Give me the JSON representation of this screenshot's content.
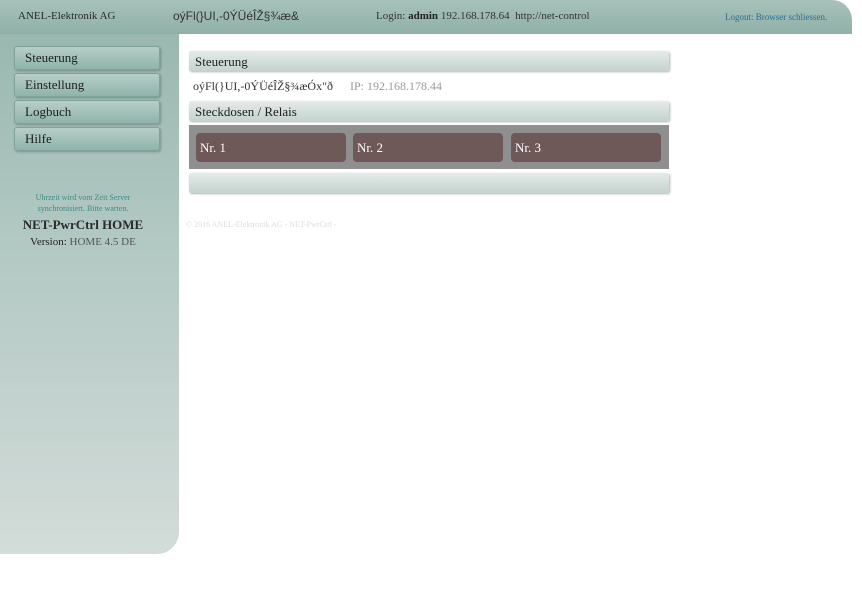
{
  "header": {
    "brand": "ANEL-Elektronik AG",
    "device_name": "oýFl(}UI,-0ÝÜéÎŽ§¾æ&",
    "login_label": "Login:",
    "login_user": "admin",
    "login_ip": "192.168.178.64",
    "login_host": "http://net-control",
    "logout": "Logout: Browser schliessen."
  },
  "sidebar": {
    "items": [
      {
        "label": "Steuerung"
      },
      {
        "label": "Einstellung"
      },
      {
        "label": "Logbuch"
      },
      {
        "label": "Hilfe"
      }
    ],
    "sync_note": "Uhrzeit wird vom Zeit Server synchronisiert. Bitte warten.",
    "product": "NET-PwrCtrl HOME",
    "version_label": "Version:",
    "version_value": "HOME 4.5 DE"
  },
  "main": {
    "title": "Steuerung",
    "device_name": "oýFl(}UI,-0ÝÜéÎŽ§¾æÓx\"ð",
    "ip": "IP: 192.168.178.44",
    "section_title": "Steckdosen / Relais",
    "relays": [
      "Nr. 1",
      "Nr. 2",
      "Nr. 3"
    ],
    "footer": "© 2016 ANEL-Elektronik AG - NET-PwrCtrl -"
  },
  "colors": {
    "header": "#8fb0a8",
    "relay_button": "#6e5858",
    "relay_area": "#8f8f8f",
    "accent_link": "#2a6f8f"
  }
}
